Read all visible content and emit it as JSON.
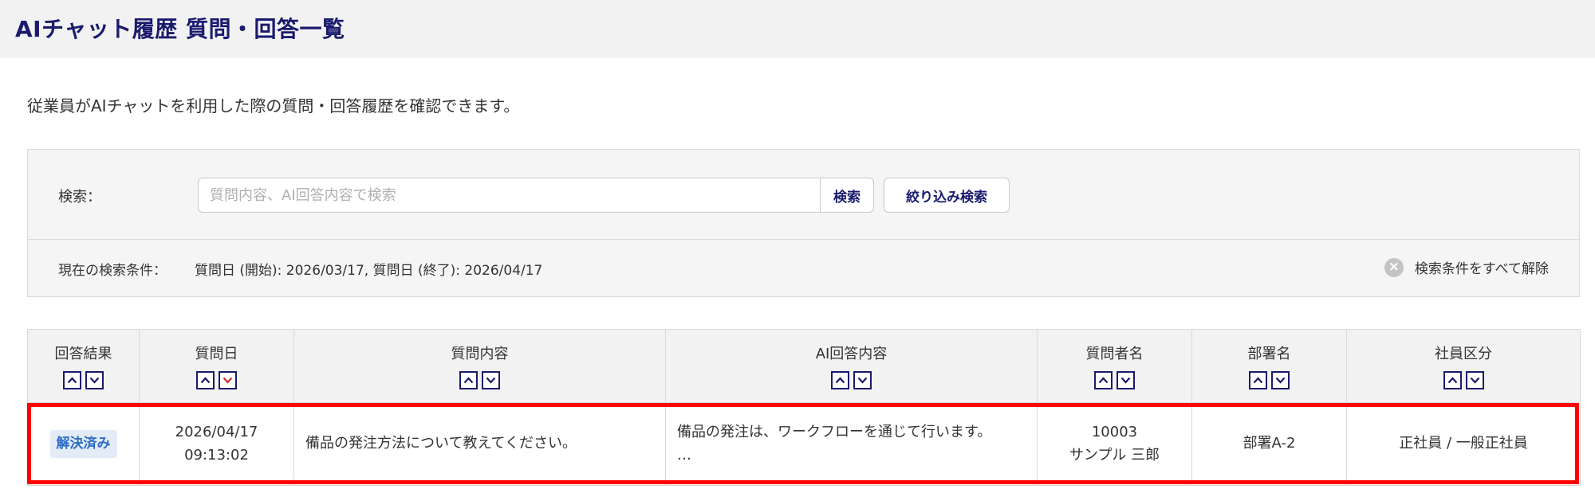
{
  "page": {
    "title": "AIチャット履歴 質問・回答一覧",
    "description": "従業員がAIチャットを利用した際の質問・回答履歴を確認できます。"
  },
  "search": {
    "label": "検索：",
    "placeholder": "質問内容、AI回答内容で検索",
    "value": "",
    "search_button": "検索",
    "filter_button": "絞り込み検索",
    "condition_label": "現在の検索条件：",
    "condition_value": "質問日 (開始): 2026/03/17, 質問日 (終了): 2026/04/17",
    "clear_all": "検索条件をすべて解除",
    "clear_icon": "close-circle-icon"
  },
  "table": {
    "columns": [
      {
        "label": "回答結果",
        "sort_desc_active": false
      },
      {
        "label": "質問日",
        "sort_desc_active": true
      },
      {
        "label": "質問内容",
        "sort_desc_active": false
      },
      {
        "label": "AI回答内容",
        "sort_desc_active": false
      },
      {
        "label": "質問者名",
        "sort_desc_active": false
      },
      {
        "label": "部署名",
        "sort_desc_active": false
      },
      {
        "label": "社員区分",
        "sort_desc_active": false
      }
    ],
    "rows": [
      {
        "status": "解決済み",
        "date": "2026/04/17",
        "time": "09:13:02",
        "question": "備品の発注方法について教えてください。",
        "answer": "備品の発注は、ワークフローを通じて行います。",
        "answer_more": "…",
        "asker_id": "10003",
        "asker_name": "サンプル 三郎",
        "department": "部署A-2",
        "employee_type": "正社員 / 一般正社員"
      }
    ]
  },
  "colors": {
    "title": "#1a1a6e",
    "sort_border": "#1a1a6e",
    "sort_arrow_active": "#d32f2f",
    "badge_bg": "#e3ebf7",
    "badge_text": "#2a6cc5",
    "highlight": "#ff0000"
  }
}
